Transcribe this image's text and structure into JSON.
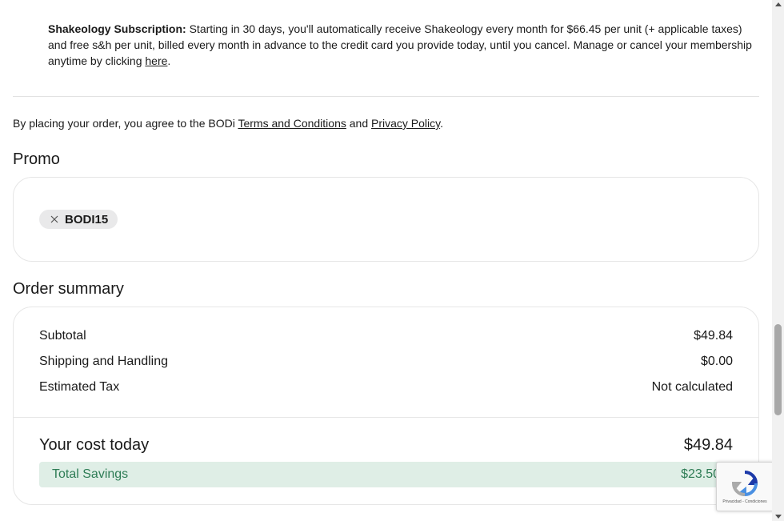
{
  "subscription": {
    "label": "Shakeology Subscription:",
    "text": " Starting in 30 days, you'll automatically receive Shakeology every month for $66.45 per unit (+ applicable taxes) and free s&h per unit, billed every month in advance to the credit card you provide today, until you cancel. Manage or cancel your membership anytime by clicking ",
    "link": "here",
    "end": "."
  },
  "legal": {
    "prefix": "By placing your order, you agree to the BODi ",
    "terms_link": "Terms and Conditions",
    "and": " and ",
    "privacy_link": "Privacy Policy",
    "end": "."
  },
  "promo": {
    "title": "Promo",
    "code": "BODI15"
  },
  "summary": {
    "title": "Order summary",
    "rows": [
      {
        "label": "Subtotal",
        "value": "$49.84"
      },
      {
        "label": "Shipping and Handling",
        "value": "$0.00"
      },
      {
        "label": "Estimated Tax",
        "value": "Not calculated"
      }
    ],
    "total_label": "Your cost today",
    "total_value": "$49.84",
    "savings_label": "Total Savings",
    "savings_value": "$23.50"
  },
  "recaptcha": {
    "legal": "Privacidad - Condiciones"
  },
  "scroll": {
    "position": 0.79
  },
  "colors": {
    "savings_bg": "#dfeee6",
    "savings_text": "#2f7d56",
    "chip_bg": "#e9e9ea"
  }
}
